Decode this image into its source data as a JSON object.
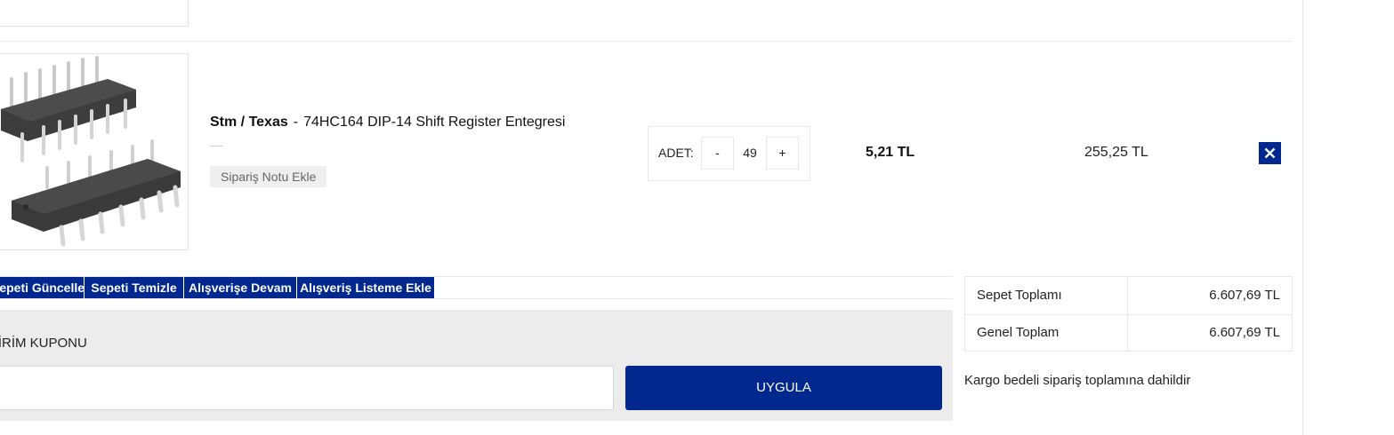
{
  "cart_item": {
    "brand": "Stm / Texas",
    "separator": "-",
    "name": "74HC164 DIP-14 Shift Register Entegresi",
    "note_button": "Sipariş Notu Ekle",
    "quantity_label": "ADET:",
    "quantity_minus": "-",
    "quantity_value": "49",
    "quantity_plus": "+",
    "unit_price": "5,21 TL",
    "line_total": "255,25 TL",
    "remove_icon": "close-icon"
  },
  "cart_actions": {
    "update": "Sepeti Güncelle",
    "clear": "Sepeti Temizle",
    "continue": "Alışverişe Devam",
    "add_to_list": "Alışveriş Listeme Ekle"
  },
  "coupon": {
    "title": "İNDİRİM KUPONU",
    "input_value": "",
    "apply_button": "UYGULA"
  },
  "totals": {
    "cart_total_label": "Sepet Toplamı",
    "cart_total_value": "6.607,69 TL",
    "grand_total_label": "Genel Toplam",
    "grand_total_value": "6.607,69 TL"
  },
  "cargo_note": "Kargo bedeli sipariş toplamına dahildir",
  "colors": {
    "primary": "#00288f",
    "panel": "#ececec",
    "border": "#e6e6e6"
  }
}
